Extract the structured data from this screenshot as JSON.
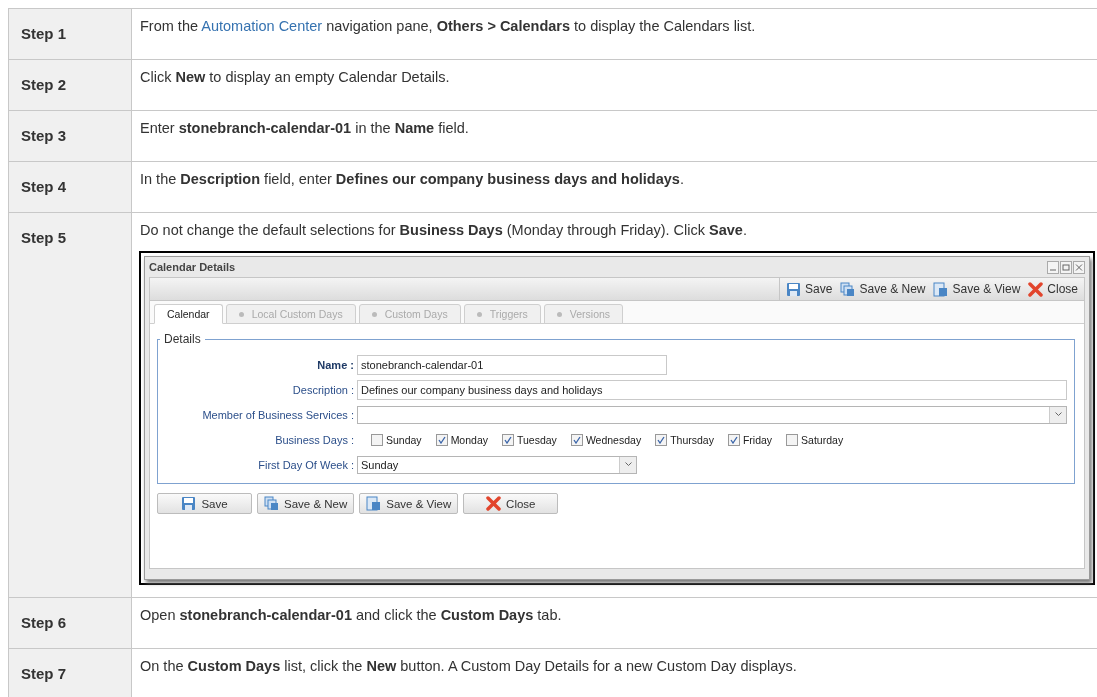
{
  "steps": [
    {
      "label": "Step 1",
      "segments": [
        {
          "kind": "text",
          "text": "From the "
        },
        {
          "kind": "link",
          "text": "Automation Center"
        },
        {
          "kind": "text",
          "text": " navigation pane, **Others > Calendars** to display the Calendars list."
        }
      ]
    },
    {
      "label": "Step 2",
      "segments": [
        {
          "kind": "text",
          "text": "Click **New** to display an empty Calendar Details."
        }
      ]
    },
    {
      "label": "Step 3",
      "segments": [
        {
          "kind": "text",
          "text": "Enter **stonebranch-calendar-01** in the **Name** field."
        }
      ]
    },
    {
      "label": "Step 4",
      "segments": [
        {
          "kind": "text",
          "text": "In the **Description** field, enter **Defines our company business days and holidays**."
        }
      ]
    },
    {
      "label": "Step 5",
      "segments": [
        {
          "kind": "text",
          "text": "Do not change the default selections for **Business Days** (Monday through Friday). Click **Save**."
        }
      ],
      "screenshot": {
        "title": "Calendar Details",
        "toolbar": [
          "Save",
          "Save & New",
          "Save & View",
          "Close"
        ],
        "tabs": [
          {
            "label": "Calendar",
            "selected": true
          },
          {
            "label": "Local Custom Days",
            "selected": false
          },
          {
            "label": "Custom Days",
            "selected": false
          },
          {
            "label": "Triggers",
            "selected": false
          },
          {
            "label": "Versions",
            "selected": false
          }
        ],
        "legend": "Details",
        "fields": [
          {
            "kind": "text",
            "label": "Name :",
            "required": true,
            "value": "stonebranch-calendar-01"
          },
          {
            "kind": "text",
            "label": "Description :",
            "required": false,
            "value": "Defines our company business days and holidays"
          },
          {
            "kind": "select",
            "label": "Member of Business Services :",
            "required": false
          },
          {
            "kind": "checkboxes",
            "label": "Business Days :",
            "required": false,
            "options": [
              {
                "label": "Sunday",
                "checked": false
              },
              {
                "label": "Monday",
                "checked": true
              },
              {
                "label": "Tuesday",
                "checked": true
              },
              {
                "label": "Wednesday",
                "checked": true
              },
              {
                "label": "Thursday",
                "checked": true
              },
              {
                "label": "Friday",
                "checked": true
              },
              {
                "label": "Saturday",
                "checked": false
              }
            ]
          },
          {
            "kind": "select",
            "label": "First Day Of Week :",
            "required": false,
            "value": "Sunday"
          }
        ],
        "buttons": [
          "Save",
          "Save & New",
          "Save & View",
          "Close"
        ]
      }
    },
    {
      "label": "Step 6",
      "segments": [
        {
          "kind": "text",
          "text": "Open **stonebranch-calendar-01** and click the **Custom Days** tab."
        }
      ]
    },
    {
      "label": "Step 7",
      "segments": [
        {
          "kind": "text",
          "text": "On the **Custom Days** list, click the **New** button. A Custom Day Details for a new Custom Day displays."
        }
      ]
    }
  ]
}
